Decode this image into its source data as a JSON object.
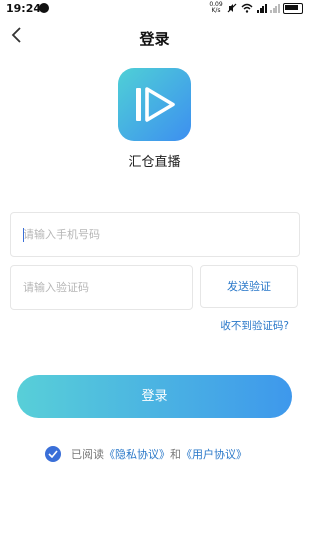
{
  "status": {
    "time": "19:24",
    "speed_top": "0.09",
    "speed_bottom": "K/s"
  },
  "header": {
    "back_icon": "chevron-left-icon",
    "title": "登录"
  },
  "app": {
    "logo_icon": "play-icon",
    "name": "汇仓直播"
  },
  "form": {
    "phone_placeholder": "请输入手机号码",
    "code_placeholder": "请输入验证码",
    "send_code_label": "发送验证",
    "no_code_link": "收不到验证码?",
    "login_label": "登录"
  },
  "agreement": {
    "prefix": "已阅读",
    "privacy": "《隐私协议》",
    "and": "和",
    "user": "《用户协议》",
    "checked": true
  },
  "colors": {
    "accent": "#3a6fd8",
    "link": "#2a78c9"
  }
}
